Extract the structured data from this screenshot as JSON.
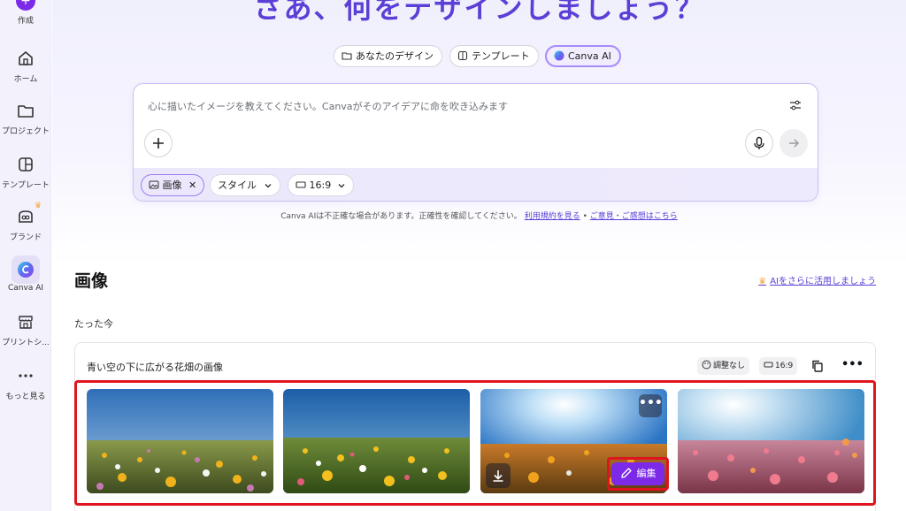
{
  "sidebar": {
    "create_label": "作成",
    "items": [
      {
        "label": "ホーム"
      },
      {
        "label": "プロジェクト"
      },
      {
        "label": "テンプレート"
      },
      {
        "label": "ブランド"
      },
      {
        "label": "Canva AI"
      },
      {
        "label": "プリントシ..."
      },
      {
        "label": "もっと見る"
      }
    ]
  },
  "hero": {
    "title": "さあ、何をデザインしましょう？"
  },
  "tabs": [
    {
      "label": "あなたのデザイン"
    },
    {
      "label": "テンプレート"
    },
    {
      "label": "Canva AI",
      "active": true
    }
  ],
  "prompt": {
    "placeholder": "心に描いたイメージを教えてください。Canvaがそのアイデアに命を吹き込みます",
    "chips": {
      "image": "画像",
      "style": "スタイル",
      "ratio": "16:9"
    }
  },
  "disclaimer": {
    "text": "Canva AIは不正確な場合があります。正確性を確認してください。",
    "terms_link": "利用規約を見る",
    "separator": "•",
    "feedback_link": "ご意見・ご感想はこちら"
  },
  "section": {
    "title": "画像",
    "ai_link": "AIをさらに活用しましょう",
    "timestamp": "たった今"
  },
  "result": {
    "title": "青い空の下に広がる花畑の画像",
    "tag_adjust": "調整なし",
    "tag_ratio": "16:9",
    "more": "•••",
    "thumb_more": "•••",
    "edit_label": "編集"
  },
  "colors": {
    "brand": "#7d2ae8",
    "title": "#5b3fd6",
    "highlight": "#e0141e"
  }
}
